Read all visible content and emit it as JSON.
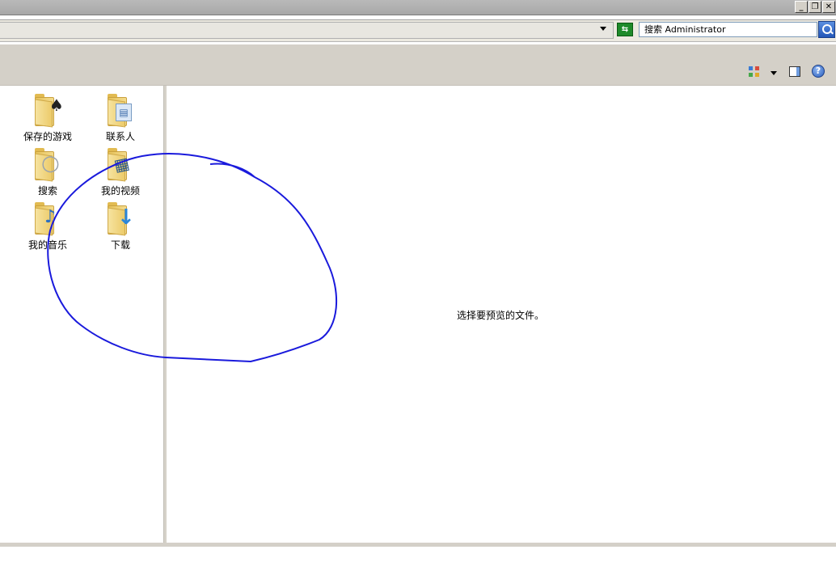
{
  "window": {
    "buttons": [
      {
        "name": "minimize",
        "glyph": "_"
      },
      {
        "name": "restore",
        "glyph": "❐"
      },
      {
        "name": "close",
        "glyph": "✕"
      }
    ]
  },
  "address_bar": {
    "search_placeholder": "搜索 Administrator",
    "refresh_glyph": "⇆"
  },
  "toolbar": {
    "help_glyph": "?"
  },
  "folders": [
    {
      "label": "保存的游戏",
      "icon": "saved-games-icon",
      "badge": "♠"
    },
    {
      "label": "联系人",
      "icon": "contacts-icon",
      "badge": "▤"
    },
    {
      "label": "搜索",
      "icon": "search-folder-icon",
      "badge": "○"
    },
    {
      "label": "我的视频",
      "icon": "videos-icon",
      "badge": "▦"
    },
    {
      "label": "我的音乐",
      "icon": "music-icon",
      "badge": "♪"
    },
    {
      "label": "下载",
      "icon": "downloads-icon",
      "badge": "↓"
    }
  ],
  "preview": {
    "message": "选择要预览的文件。"
  },
  "colors": {
    "annotation": "#1a1adc",
    "selection_blue": "#2457b8"
  }
}
